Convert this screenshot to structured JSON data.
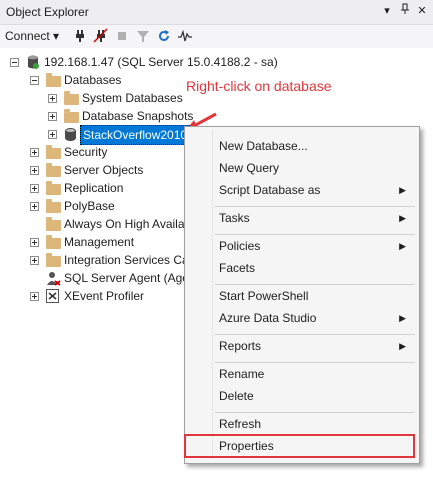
{
  "window": {
    "title": "Object Explorer"
  },
  "toolbar": {
    "connect_label": "Connect ▾"
  },
  "tree": {
    "server": "192.168.1.47 (SQL Server 15.0.4188.2 - sa)",
    "databases": "Databases",
    "system_databases": "System Databases",
    "database_snapshots": "Database Snapshots",
    "stackoverflow": "StackOverflow2010",
    "security": "Security",
    "server_objects": "Server Objects",
    "replication": "Replication",
    "polybase": "PolyBase",
    "always_on": "Always On High Availa",
    "management": "Management",
    "integration_services": "Integration Services Ca",
    "sql_agent": "SQL Server Agent (Age",
    "xevent": "XEvent Profiler"
  },
  "annotation": {
    "text": "Right-click on database",
    "color": "#e0373c"
  },
  "context_menu": {
    "new_database": "New Database...",
    "new_query": "New Query",
    "script_database_as": "Script Database as",
    "tasks": "Tasks",
    "policies": "Policies",
    "facets": "Facets",
    "start_powershell": "Start PowerShell",
    "azure_data_studio": "Azure Data Studio",
    "reports": "Reports",
    "rename": "Rename",
    "delete": "Delete",
    "refresh": "Refresh",
    "properties": "Properties"
  },
  "icons": {
    "pin": "▾",
    "pushpin": "⊥",
    "close": "✕",
    "submenu_arrow": "▶"
  },
  "colors": {
    "selection": "#0078d7",
    "highlight": "#e0373c",
    "folder": "#dcb67a"
  }
}
